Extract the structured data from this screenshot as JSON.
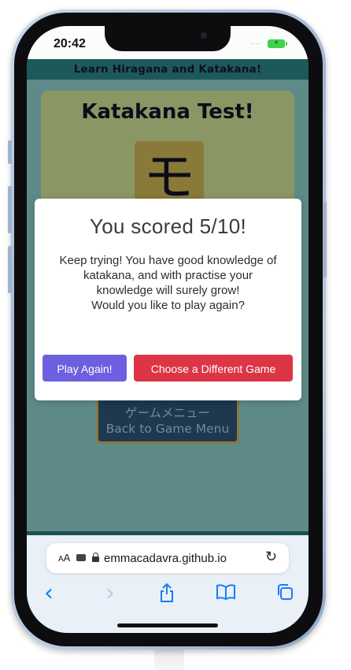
{
  "status_bar": {
    "time": "20:42",
    "signal": "....",
    "battery": "⚡"
  },
  "site": {
    "header": "Learn Hiragana and Katakana!",
    "test_title": "Katakana Test!",
    "test_character": "モ",
    "menu_button": {
      "japanese": "ゲームメニュー",
      "english": "Back to Game Menu"
    }
  },
  "modal": {
    "title": "You scored 5/10!",
    "message_line1": "Keep trying! You have good knowledge of katakana, and with practise your knowledge will surely grow!",
    "message_line2": "Would you like to play again?",
    "play_again": "Play Again!",
    "choose_game": "Choose a Different Game"
  },
  "browser": {
    "text_size": "AA",
    "url": "emmacadavra.github.io",
    "reload": "↻",
    "nav": {
      "back": "‹",
      "forward": "›",
      "share": "⇧",
      "bookmarks": "📖",
      "tabs": "⧉"
    }
  },
  "colors": {
    "modal_play_button": "#6c5fe0",
    "modal_choose_button": "#dc3545",
    "header_bg": "#1e5959",
    "overlay_bg": "#5e8a88"
  }
}
